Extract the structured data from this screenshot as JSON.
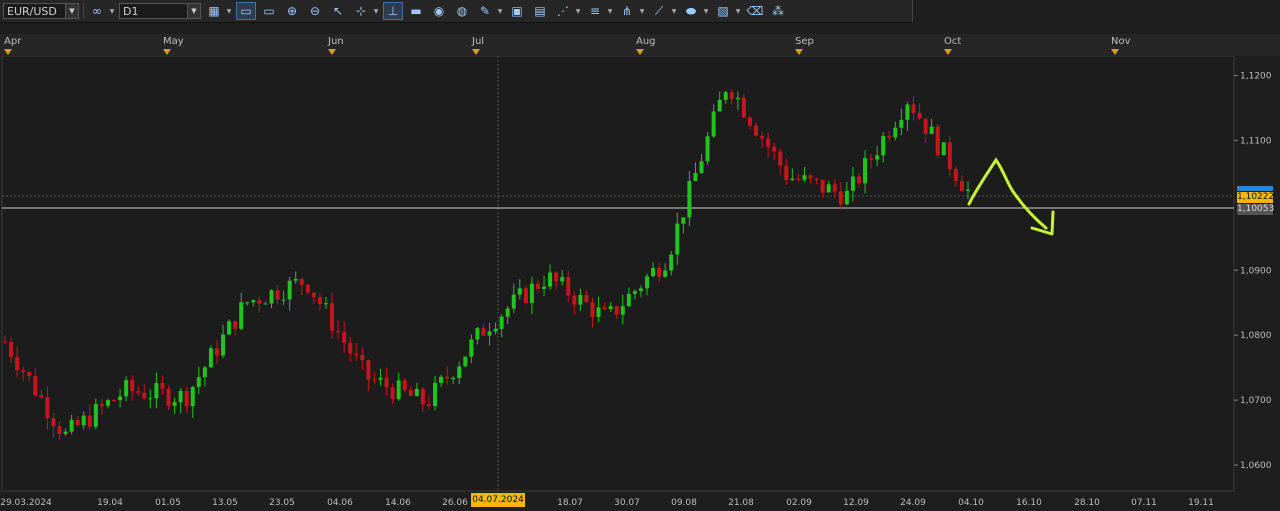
{
  "toolbar": {
    "symbol": "EUR/USD",
    "timeframe": "D1",
    "buttons": [
      {
        "name": "link-icon",
        "glyph": "∞"
      },
      {
        "name": "chart-type-icon",
        "glyph": "▦"
      },
      {
        "name": "bid-icon",
        "glyph": "▭"
      },
      {
        "name": "ask-icon",
        "glyph": "▭"
      },
      {
        "name": "zoom-in-icon",
        "glyph": "⊕"
      },
      {
        "name": "zoom-out-icon",
        "glyph": "⊖"
      },
      {
        "name": "cursor-icon",
        "glyph": "↖"
      },
      {
        "name": "crosshair-icon",
        "glyph": "⊹"
      },
      {
        "name": "line-study-icon",
        "glyph": "⊥"
      },
      {
        "name": "note-icon",
        "glyph": "▬"
      },
      {
        "name": "camera-icon",
        "glyph": "◉"
      },
      {
        "name": "globe-icon",
        "glyph": "◍"
      },
      {
        "name": "pencil-icon",
        "glyph": "✎"
      },
      {
        "name": "image-icon",
        "glyph": "▣"
      },
      {
        "name": "window-icon",
        "glyph": "▤"
      },
      {
        "name": "fan-icon",
        "glyph": "⋰"
      },
      {
        "name": "fib-icon",
        "glyph": "≡"
      },
      {
        "name": "pitchfork-icon",
        "glyph": "⋔"
      },
      {
        "name": "trend-icon",
        "glyph": "⟋"
      },
      {
        "name": "ellipse-icon",
        "glyph": "⬬"
      },
      {
        "name": "monitor-icon",
        "glyph": "▧"
      },
      {
        "name": "eraser-icon",
        "glyph": "⌫"
      },
      {
        "name": "indicators-icon",
        "glyph": "⁂"
      }
    ]
  },
  "chart": {
    "months": [
      "Apr",
      "May",
      "Jun",
      "Jul",
      "Aug",
      "Sep",
      "Oct",
      "Nov"
    ],
    "price_labels": [
      "1,1200",
      "1,1100",
      "1,0900",
      "1,0800",
      "1,0700",
      "1,0600"
    ],
    "date_labels": [
      "29.03.2024",
      "19.04",
      "01.05",
      "13.05",
      "23.05",
      "04.06",
      "14.06",
      "26.06",
      "18.07",
      "30.07",
      "09.08",
      "21.08",
      "02.09",
      "12.09",
      "24.09",
      "04.10",
      "16.10",
      "28.10",
      "07.11",
      "19.11"
    ],
    "crosshair_date": "04.07.2024",
    "current_price": "1,10222",
    "line_price": "1,10053",
    "colors": {
      "up": "#22c21f",
      "down": "#c4161c",
      "annotation": "#c6f236",
      "marker": "#d4a017"
    }
  },
  "chart_data": {
    "type": "candlestick",
    "symbol": "EUR/USD",
    "timeframe": "D1",
    "y_range": [
      1.056,
      1.123
    ],
    "x": [
      "29.03.2024",
      "19.04",
      "01.05",
      "13.05",
      "23.05",
      "04.06",
      "14.06",
      "26.06",
      "04.07",
      "18.07",
      "30.07",
      "09.08",
      "21.08",
      "02.09",
      "12.09",
      "24.09",
      "04.10"
    ],
    "close": [
      1.079,
      1.0645,
      1.0715,
      1.0705,
      1.085,
      1.0885,
      1.0735,
      1.0695,
      1.0815,
      1.089,
      1.0825,
      1.092,
      1.119,
      1.1045,
      1.1015,
      1.1165,
      1.1022
    ],
    "horizontal_line": 1.10053
  }
}
